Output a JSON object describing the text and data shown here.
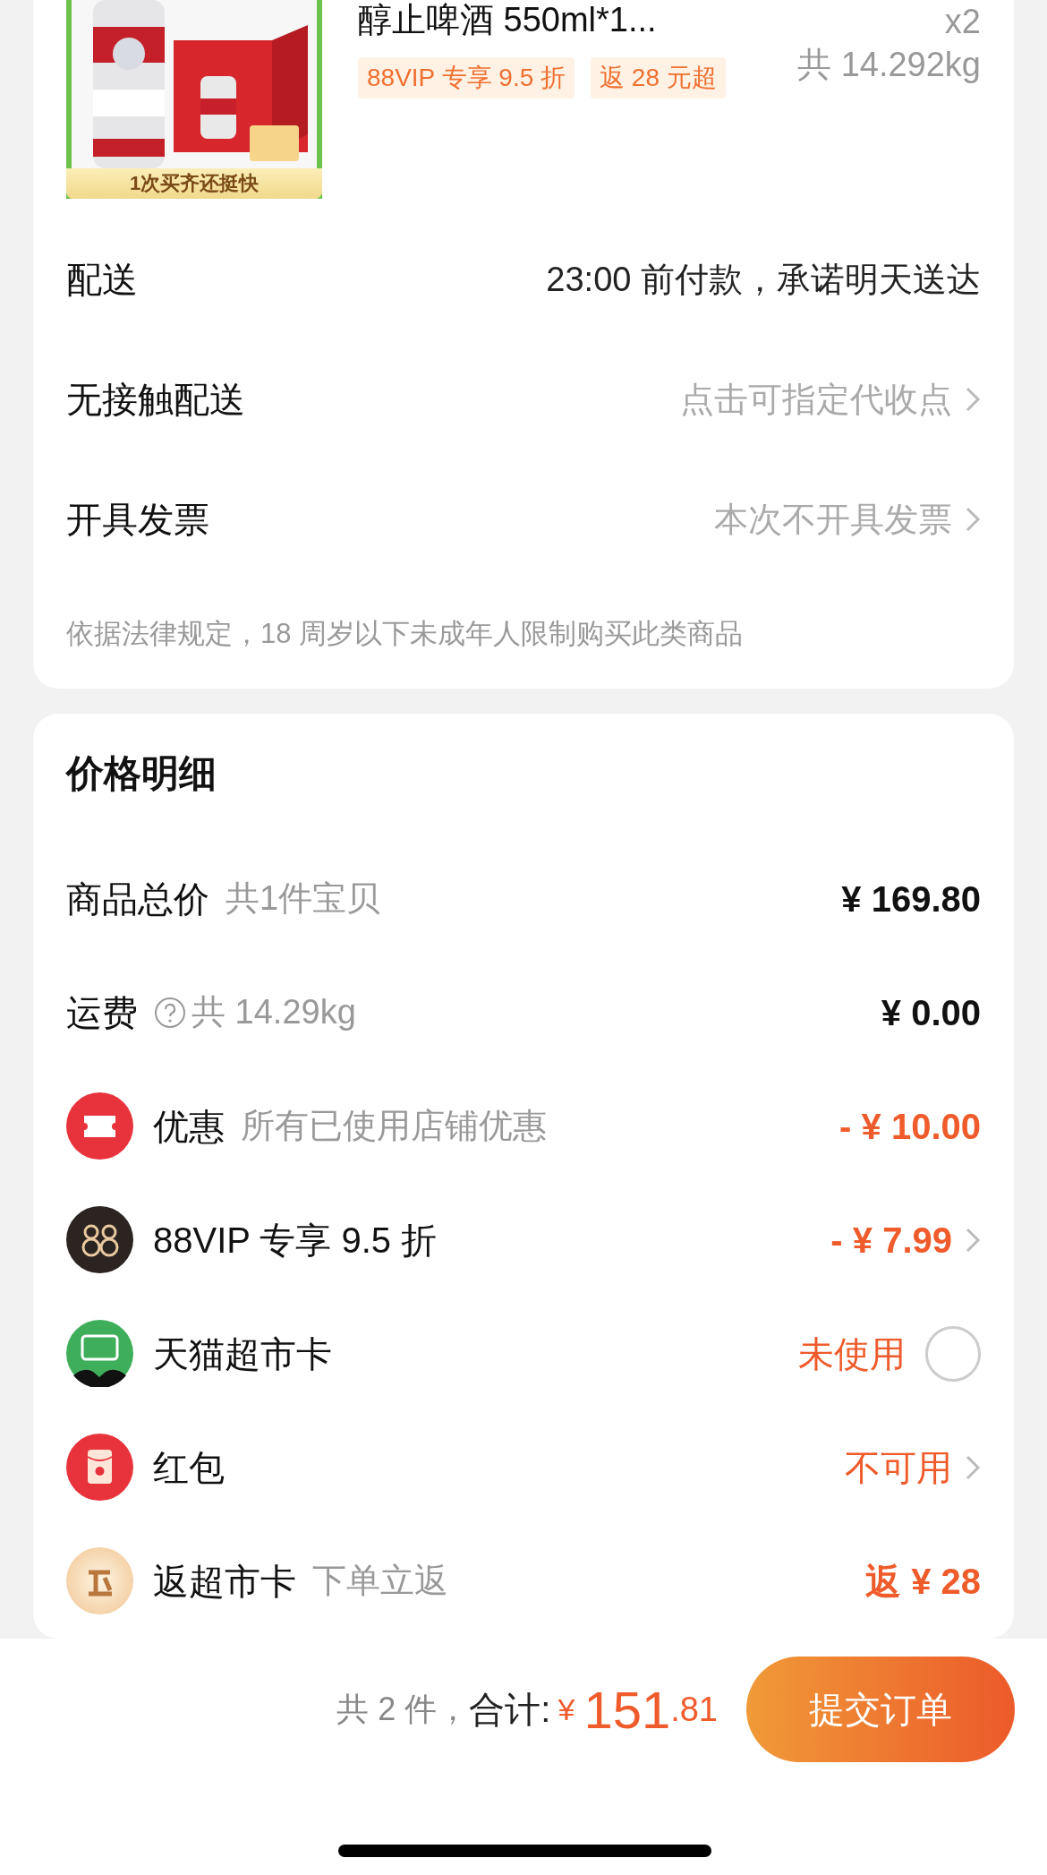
{
  "product": {
    "title": "醇止啤酒 550ml*1...",
    "banner": "1次买齐还挺快",
    "tags": [
      "88VIP 专享 9.5 折",
      "返 28 元超"
    ],
    "quantity": "x2",
    "weight": "共 14.292kg"
  },
  "order_rows": [
    {
      "label": "配送",
      "value": "23:00 前付款，承诺明天送达",
      "muted": false,
      "chevron": false
    },
    {
      "label": "无接触配送",
      "value": "点击可指定代收点",
      "muted": true,
      "chevron": true
    },
    {
      "label": "开具发票",
      "value": "本次不开具发票",
      "muted": true,
      "chevron": true
    }
  ],
  "notice": "依据法律规定，18 周岁以下未成年人限制购买此类商品",
  "price_details": {
    "title": "价格明细",
    "rows": [
      {
        "kind": "plain",
        "label": "商品总价",
        "note": "共1件宝贝",
        "value": "¥ 169.80",
        "highlight": false,
        "help": false,
        "chevron": false
      },
      {
        "kind": "plain",
        "label": "运费",
        "note": "共 14.29kg",
        "value": "¥ 0.00",
        "highlight": false,
        "help": true,
        "chevron": false
      },
      {
        "kind": "coupon",
        "label": "优惠",
        "note": "所有已使用店铺优惠",
        "value": "- ¥ 10.00",
        "highlight": true,
        "help": false,
        "chevron": false
      },
      {
        "kind": "vip",
        "label": "88VIP 专享 9.5 折",
        "value": "- ¥ 7.99",
        "highlight": true,
        "help": false,
        "chevron": true
      },
      {
        "kind": "card",
        "label": "天猫超市卡",
        "value": "未使用",
        "highlight": true,
        "help": false,
        "chevron": false,
        "radio": {
          "checked": false
        }
      },
      {
        "kind": "redpacket",
        "label": "红包",
        "value": "不可用",
        "highlight": true,
        "help": false,
        "chevron": true
      },
      {
        "kind": "rebate",
        "label": "返超市卡",
        "note": "下单立返",
        "value": "返 ¥ 28",
        "highlight": true,
        "help": false,
        "chevron": false
      }
    ]
  },
  "footer": {
    "count": "共 2 件，",
    "total_label": "合计:",
    "currency": "¥",
    "amount_int": "151",
    "amount_dec": ".81",
    "submit": "提交订单"
  }
}
